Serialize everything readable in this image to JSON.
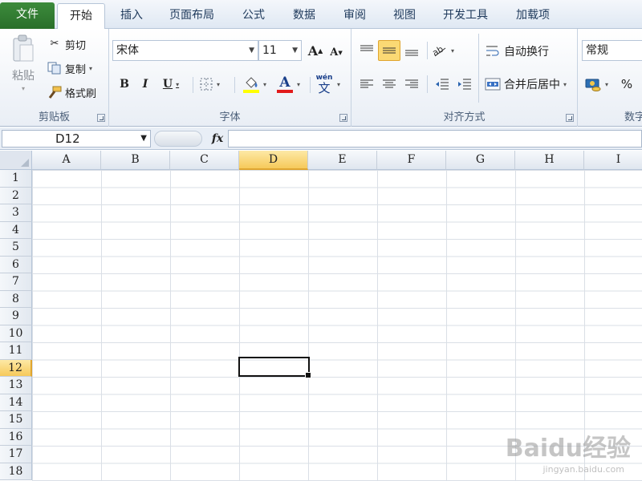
{
  "tabs": [
    "文件",
    "开始",
    "插入",
    "页面布局",
    "公式",
    "数据",
    "审阅",
    "视图",
    "开发工具",
    "加载项"
  ],
  "active_tab": "开始",
  "ribbon": {
    "clipboard": {
      "label": "剪贴板",
      "paste": "粘贴",
      "cut": "剪切",
      "copy": "复制",
      "format_painter": "格式刷"
    },
    "font": {
      "label": "字体",
      "font_name": "宋体",
      "font_size": "11",
      "bold": "B",
      "italic": "I",
      "underline": "U",
      "grow": "A",
      "shrink": "A",
      "font_color": "A",
      "phonetic": "wén"
    },
    "alignment": {
      "label": "对齐方式",
      "wrap_text": "自动换行",
      "merge_center": "合并后居中"
    },
    "number": {
      "label": "数字",
      "format": "常规",
      "percent": "%"
    }
  },
  "formula_bar": {
    "name_box": "D12",
    "fx": "fx",
    "formula": ""
  },
  "grid": {
    "columns": [
      "A",
      "B",
      "C",
      "D",
      "E",
      "F",
      "G",
      "H",
      "I"
    ],
    "rows": [
      "1",
      "2",
      "3",
      "4",
      "5",
      "6",
      "7",
      "8",
      "9",
      "10",
      "11",
      "12",
      "13",
      "14",
      "15",
      "16",
      "17",
      "18"
    ],
    "selected_column": "D",
    "selected_row": "12",
    "active_cell": "D12"
  },
  "watermark": {
    "brand": "Baidu经验",
    "url": "jingyan.baidu.com"
  },
  "colors": {
    "file_tab": "#2a6f2a",
    "selection_header": "#f6c95a",
    "grid_line": "#dadfe6"
  }
}
